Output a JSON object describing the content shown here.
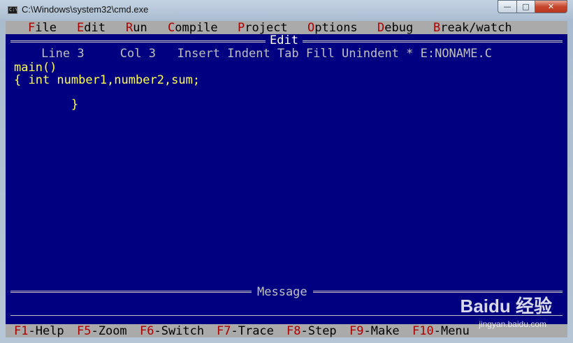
{
  "window": {
    "title": "C:\\Windows\\system32\\cmd.exe",
    "icon_label": "C:\\",
    "min_glyph": "—",
    "max_glyph": "□",
    "close_glyph": "✕"
  },
  "menubar": [
    {
      "hot": "F",
      "rest": "ile"
    },
    {
      "hot": "E",
      "rest": "dit"
    },
    {
      "hot": "R",
      "rest": "un"
    },
    {
      "hot": "C",
      "rest": "ompile"
    },
    {
      "hot": "P",
      "rest": "roject"
    },
    {
      "hot": "O",
      "rest": "ptions"
    },
    {
      "hot": "D",
      "rest": "ebug"
    },
    {
      "hot": "B",
      "rest": "reak/watch"
    }
  ],
  "editor": {
    "title": "Edit",
    "status": "     Line 3     Col 3   Insert Indent Tab Fill Unindent * E:NONAME.C",
    "code_lines": [
      "main()",
      "{ int number1,number2,sum;",
      "",
      "        }"
    ]
  },
  "message": {
    "title": "Message"
  },
  "fkeys": [
    {
      "key": "F1",
      "label": "-Help"
    },
    {
      "key": "F5",
      "label": "-Zoom"
    },
    {
      "key": "F6",
      "label": "-Switch"
    },
    {
      "key": "F7",
      "label": "-Trace"
    },
    {
      "key": "F8",
      "label": "-Step"
    },
    {
      "key": "F9",
      "label": "-Make"
    },
    {
      "key": "F10",
      "label": "-Menu"
    }
  ],
  "watermark": {
    "brand": "Baidu 经验",
    "url": "jingyan.baidu.com"
  },
  "colors": {
    "editor_bg": "#000080",
    "code_fg": "#ffff55",
    "menu_bg": "#aaaaaa",
    "hotkey": "#aa0000"
  }
}
